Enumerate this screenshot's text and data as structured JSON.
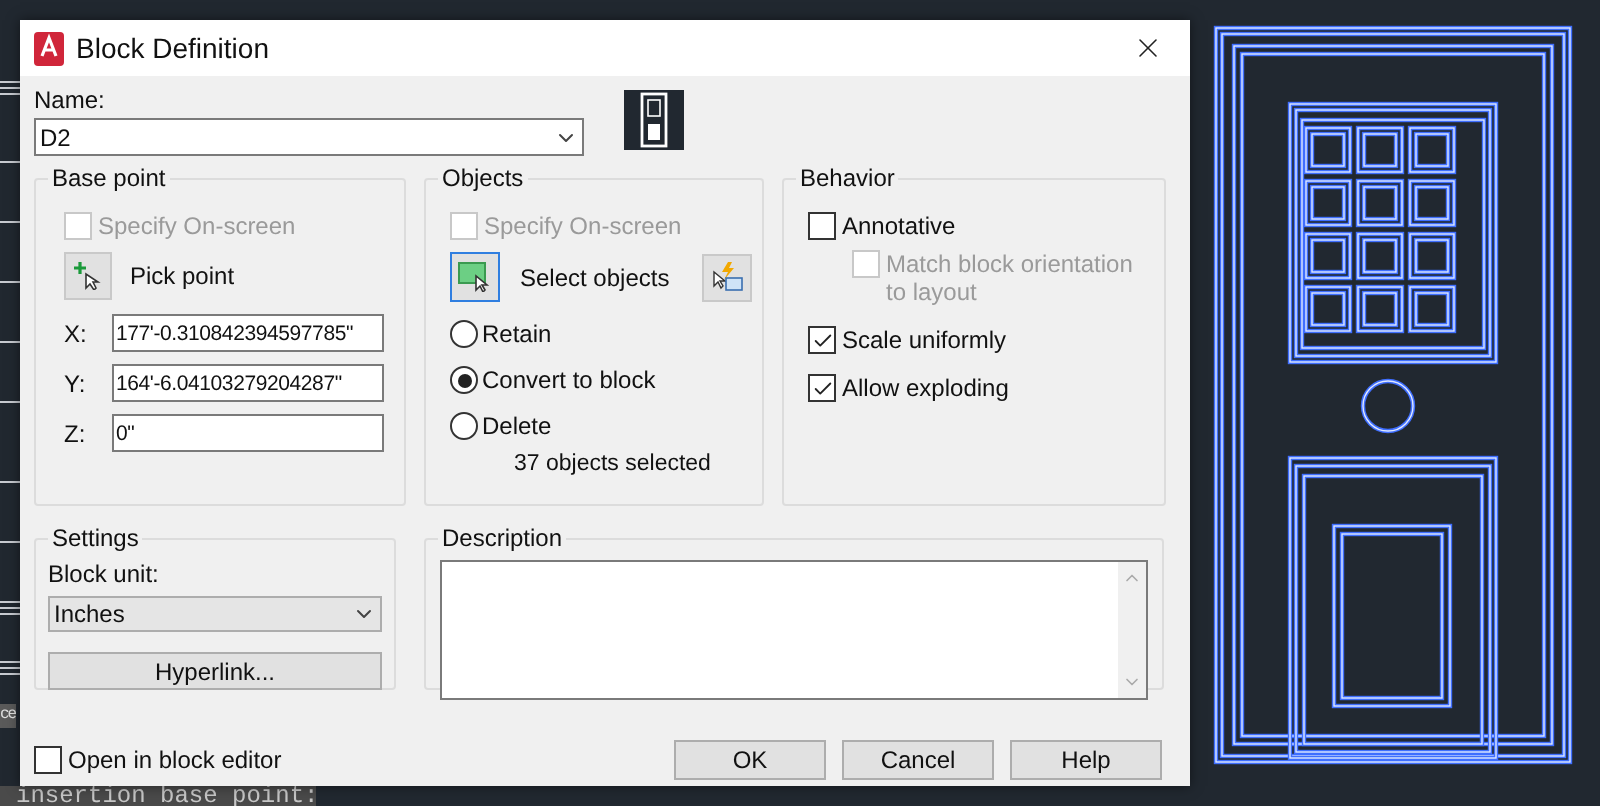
{
  "window": {
    "title": "Block Definition"
  },
  "name": {
    "label": "Name:",
    "value": "D2"
  },
  "base_point": {
    "title": "Base point",
    "specify_on_screen": {
      "label": "Specify On-screen",
      "checked": false,
      "disabled": true
    },
    "pick_button": "Pick point",
    "fields": [
      {
        "label": "X:",
        "value": "177'-0.310842394597785\""
      },
      {
        "label": "Y:",
        "value": "164'-6.04103279204287\""
      },
      {
        "label": "Z:",
        "value": "0\""
      }
    ]
  },
  "objects": {
    "title": "Objects",
    "specify_on_screen": {
      "label": "Specify On-screen",
      "checked": false,
      "disabled": true
    },
    "select_button": "Select objects",
    "options": [
      {
        "label": "Retain",
        "selected": false
      },
      {
        "label": "Convert to block",
        "selected": true
      },
      {
        "label": "Delete",
        "selected": false
      }
    ],
    "count": "37 objects selected"
  },
  "behavior": {
    "title": "Behavior",
    "options": [
      {
        "label": "Annotative",
        "checked": false,
        "disabled": false,
        "children": [
          {
            "label": "Match block orientation to layout",
            "checked": false,
            "disabled": true
          }
        ]
      },
      {
        "label": "Scale uniformly",
        "checked": true,
        "disabled": false
      },
      {
        "label": "Allow exploding",
        "checked": true,
        "disabled": false
      }
    ]
  },
  "settings": {
    "title": "Settings",
    "unit_label": "Block unit:",
    "unit_value": "Inches",
    "hyperlink_button": "Hyperlink..."
  },
  "description": {
    "title": "Description"
  },
  "open_in_editor": {
    "label": "Open in block editor",
    "checked": false
  },
  "buttons": [
    "OK",
    "Cancel",
    "Help"
  ],
  "command_line": [
    "ce",
    "insertion base point:"
  ]
}
